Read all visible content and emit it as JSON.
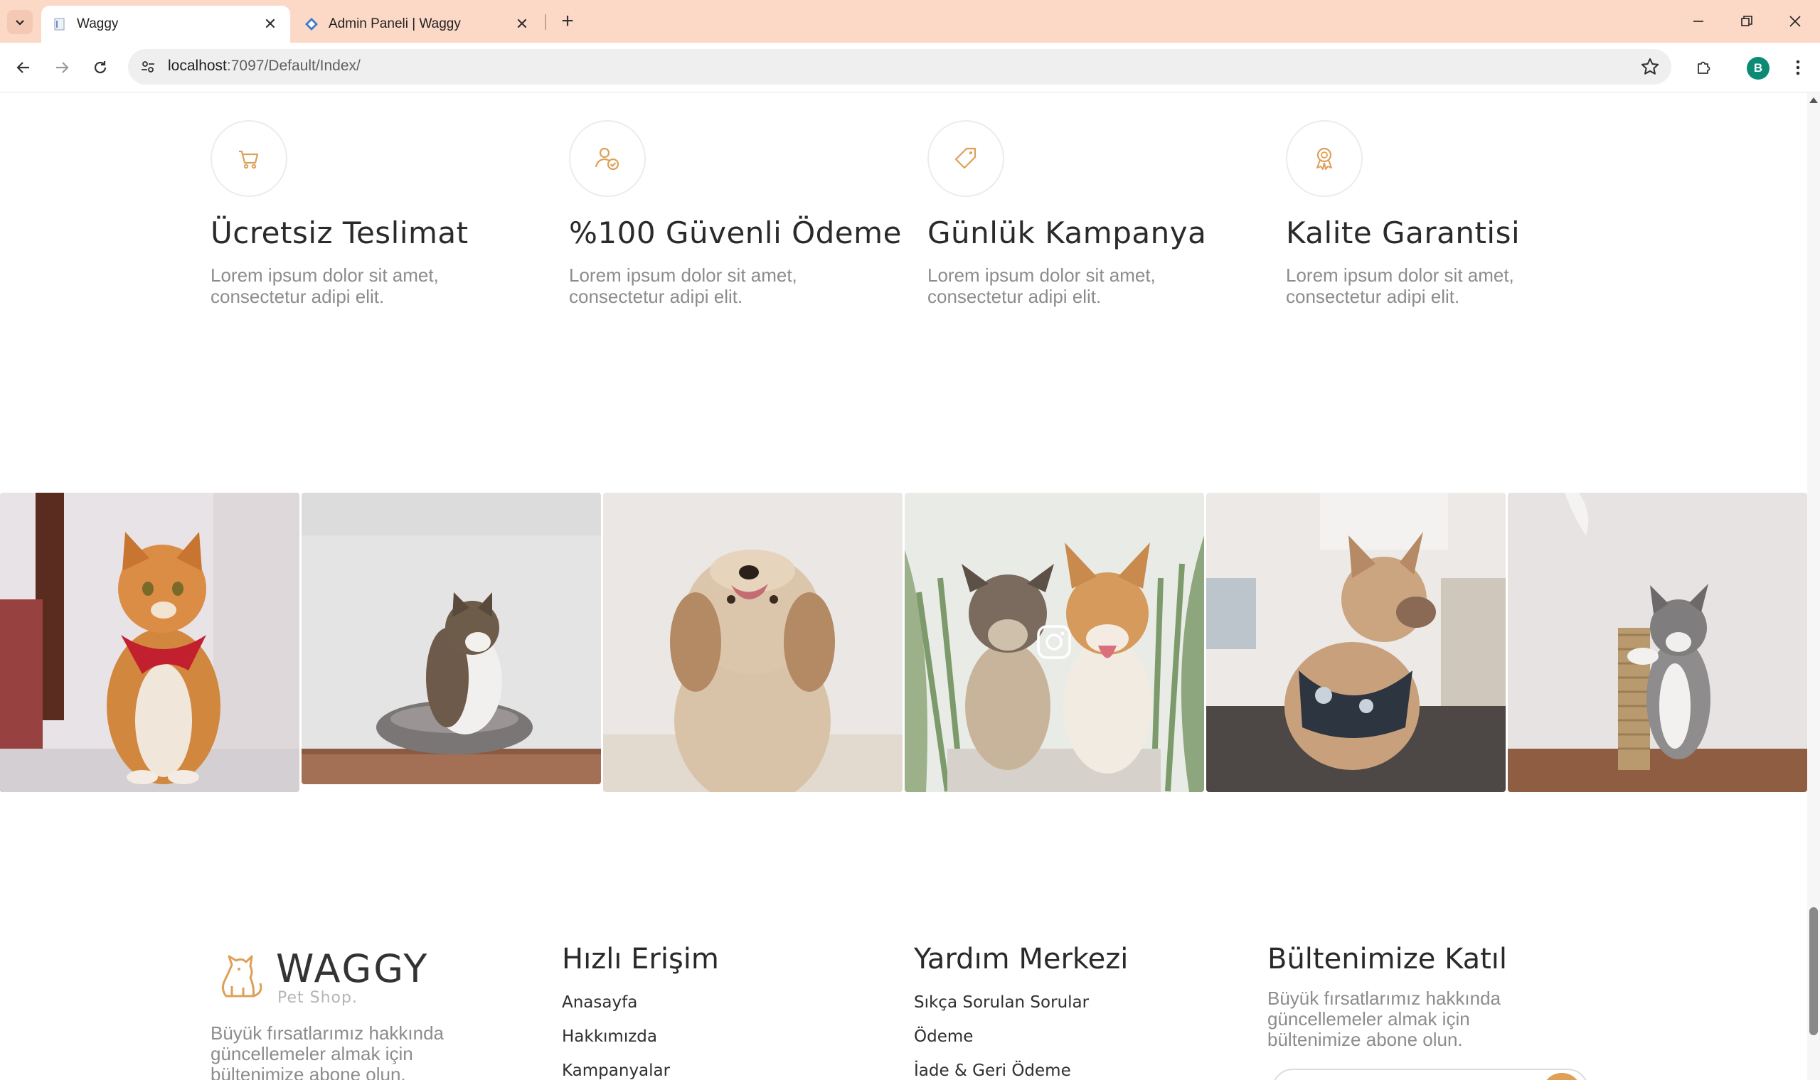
{
  "browser": {
    "tabs": [
      {
        "title": "Waggy",
        "active": true
      },
      {
        "title": "Admin Paneli | Waggy",
        "active": false
      }
    ],
    "url_host": "localhost",
    "url_path": ":7097/Default/Index/",
    "profile_initial": "B"
  },
  "features": [
    {
      "icon": "cart-icon",
      "title": "Ücretsiz Teslimat",
      "text": "Lorem ipsum dolor sit amet, consectetur adipi elit."
    },
    {
      "icon": "user-check-icon",
      "title": "%100 Güvenli Ödeme",
      "text": "Lorem ipsum dolor sit amet, consectetur adipi elit."
    },
    {
      "icon": "tag-icon",
      "title": "Günlük Kampanya",
      "text": "Lorem ipsum dolor sit amet, consectetur adipi elit."
    },
    {
      "icon": "award-icon",
      "title": "Kalite Garantisi",
      "text": "Lorem ipsum dolor sit amet, consectetur adipi elit."
    }
  ],
  "gallery": [
    {
      "subject": "ginger cat with red bandana"
    },
    {
      "subject": "tabby cat on cushion"
    },
    {
      "subject": "fluffy dog looking up"
    },
    {
      "subject": "two running dogs",
      "overlay_icon": "instagram-icon"
    },
    {
      "subject": "french bulldog on table"
    },
    {
      "subject": "kitten on scratching post"
    }
  ],
  "footer": {
    "logo": {
      "name": "WAGGY",
      "tagline": "Pet Shop."
    },
    "about": "Büyük fırsatlarımız hakkında güncellemeler almak için bültenimize abone olun.",
    "quick_access": {
      "title": "Hızlı Erişim",
      "links": [
        "Anasayfa",
        "Hakkımızda",
        "Kampanyalar"
      ]
    },
    "help_center": {
      "title": "Yardım Merkezi",
      "links": [
        "Sıkça Sorulan Sorular",
        "Ödeme",
        "İade & Geri Ödeme"
      ]
    },
    "newsletter": {
      "title": "Bültenimize Katıl",
      "text": "Büyük fırsatlarımız hakkında güncellemeler almak için bültenimize abone olun."
    }
  },
  "colors": {
    "accent": "#dea057",
    "tabbar": "#fcd9c7",
    "heading": "#2a2a2a",
    "muted": "#8c8c8c"
  }
}
